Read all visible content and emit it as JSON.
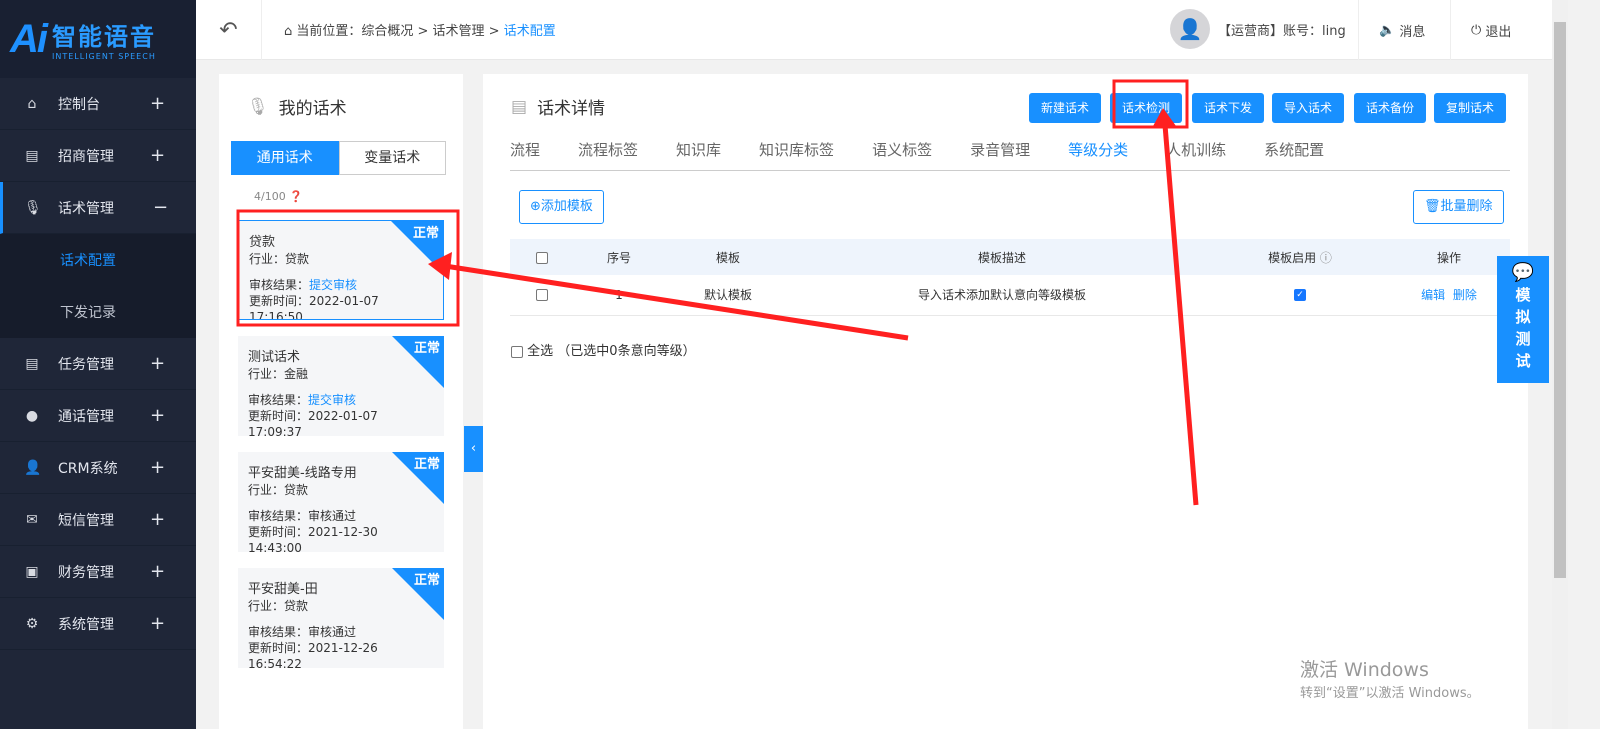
{
  "app": {
    "logo_text": "Ai",
    "title": "智能语音",
    "subtitle": "INTELLIGENT SPEECH"
  },
  "sidebar": {
    "items": [
      {
        "label": "控制台",
        "icon": "home-icon",
        "toggle": "+"
      },
      {
        "label": "招商管理",
        "icon": "clipboard-icon",
        "toggle": "+"
      },
      {
        "label": "话术管理",
        "icon": "mic-icon",
        "toggle": "−"
      },
      {
        "label": "任务管理",
        "icon": "clipboard-icon",
        "toggle": "+"
      },
      {
        "label": "通话管理",
        "icon": "phone-icon",
        "toggle": "+"
      },
      {
        "label": "CRM系统",
        "icon": "user-icon",
        "toggle": "+"
      },
      {
        "label": "短信管理",
        "icon": "mail-icon",
        "toggle": "+"
      },
      {
        "label": "财务管理",
        "icon": "wallet-icon",
        "toggle": "+"
      },
      {
        "label": "系统管理",
        "icon": "gear-icon",
        "toggle": "+"
      }
    ],
    "sub_items": [
      {
        "label": "话术配置"
      },
      {
        "label": "下发记录"
      }
    ]
  },
  "header": {
    "breadcrumb_prefix": "当前位置：综合概况 > 话术管理 > ",
    "breadcrumb_current": "话术配置",
    "account": "【运营商】账号：ling",
    "messages": "消息",
    "logout": "退出"
  },
  "left": {
    "title": "我的话术",
    "seg": [
      "通用话术",
      "变量话术"
    ],
    "count": "4/100",
    "cards": [
      {
        "name": "贷款",
        "industry": "行业：贷款",
        "audit_label": "审核结果：",
        "audit": "提交审核",
        "audit_link": true,
        "updated": "更新时间：2022-01-07 17:16:50",
        "tag": "正常"
      },
      {
        "name": "测试话术",
        "industry": "行业：金融",
        "audit_label": "审核结果：",
        "audit": "提交审核",
        "audit_link": true,
        "updated": "更新时间：2022-01-07 17:09:37",
        "tag": "正常"
      },
      {
        "name": "平安甜美-线路专用",
        "industry": "行业：贷款",
        "audit_label": "审核结果：",
        "audit": "审核通过",
        "audit_link": false,
        "updated": "更新时间：2021-12-30 14:43:00",
        "tag": "正常"
      },
      {
        "name": "平安甜美-田",
        "industry": "行业：贷款",
        "audit_label": "审核结果：",
        "audit": "审核通过",
        "audit_link": false,
        "updated": "更新时间：2021-12-26 16:54:22",
        "tag": "正常"
      }
    ]
  },
  "right": {
    "title": "话术详情",
    "buttons": [
      "新建话术",
      "话术检测",
      "话术下发",
      "导入话术",
      "话术备份",
      "复制话术"
    ],
    "tabs": [
      "流程",
      "流程标签",
      "知识库",
      "知识库标签",
      "语义标签",
      "录音管理",
      "等级分类",
      "人机训练",
      "系统配置"
    ],
    "active_tab": "等级分类",
    "add_template": "添加模板",
    "batch_delete": "批量删除",
    "table": {
      "headers": [
        "序号",
        "模板",
        "模板描述",
        "模板启用",
        "操作"
      ],
      "rows": [
        {
          "index": "1",
          "template": "默认模板",
          "desc": "导入话术添加默认意向等级模板",
          "enabled": true,
          "edit": "编辑",
          "delete": "删除"
        }
      ]
    },
    "select_all": "全选",
    "selected_info": "（已选中0条意向等级）"
  },
  "float_button": [
    "模",
    "拟",
    "测",
    "试"
  ],
  "watermark": {
    "line1": "激活 Windows",
    "line2": "转到“设置”以激活 Windows。"
  },
  "colors": {
    "primary": "#1890ff",
    "sidebar": "#1f2638",
    "annotation": "#ff2020"
  }
}
